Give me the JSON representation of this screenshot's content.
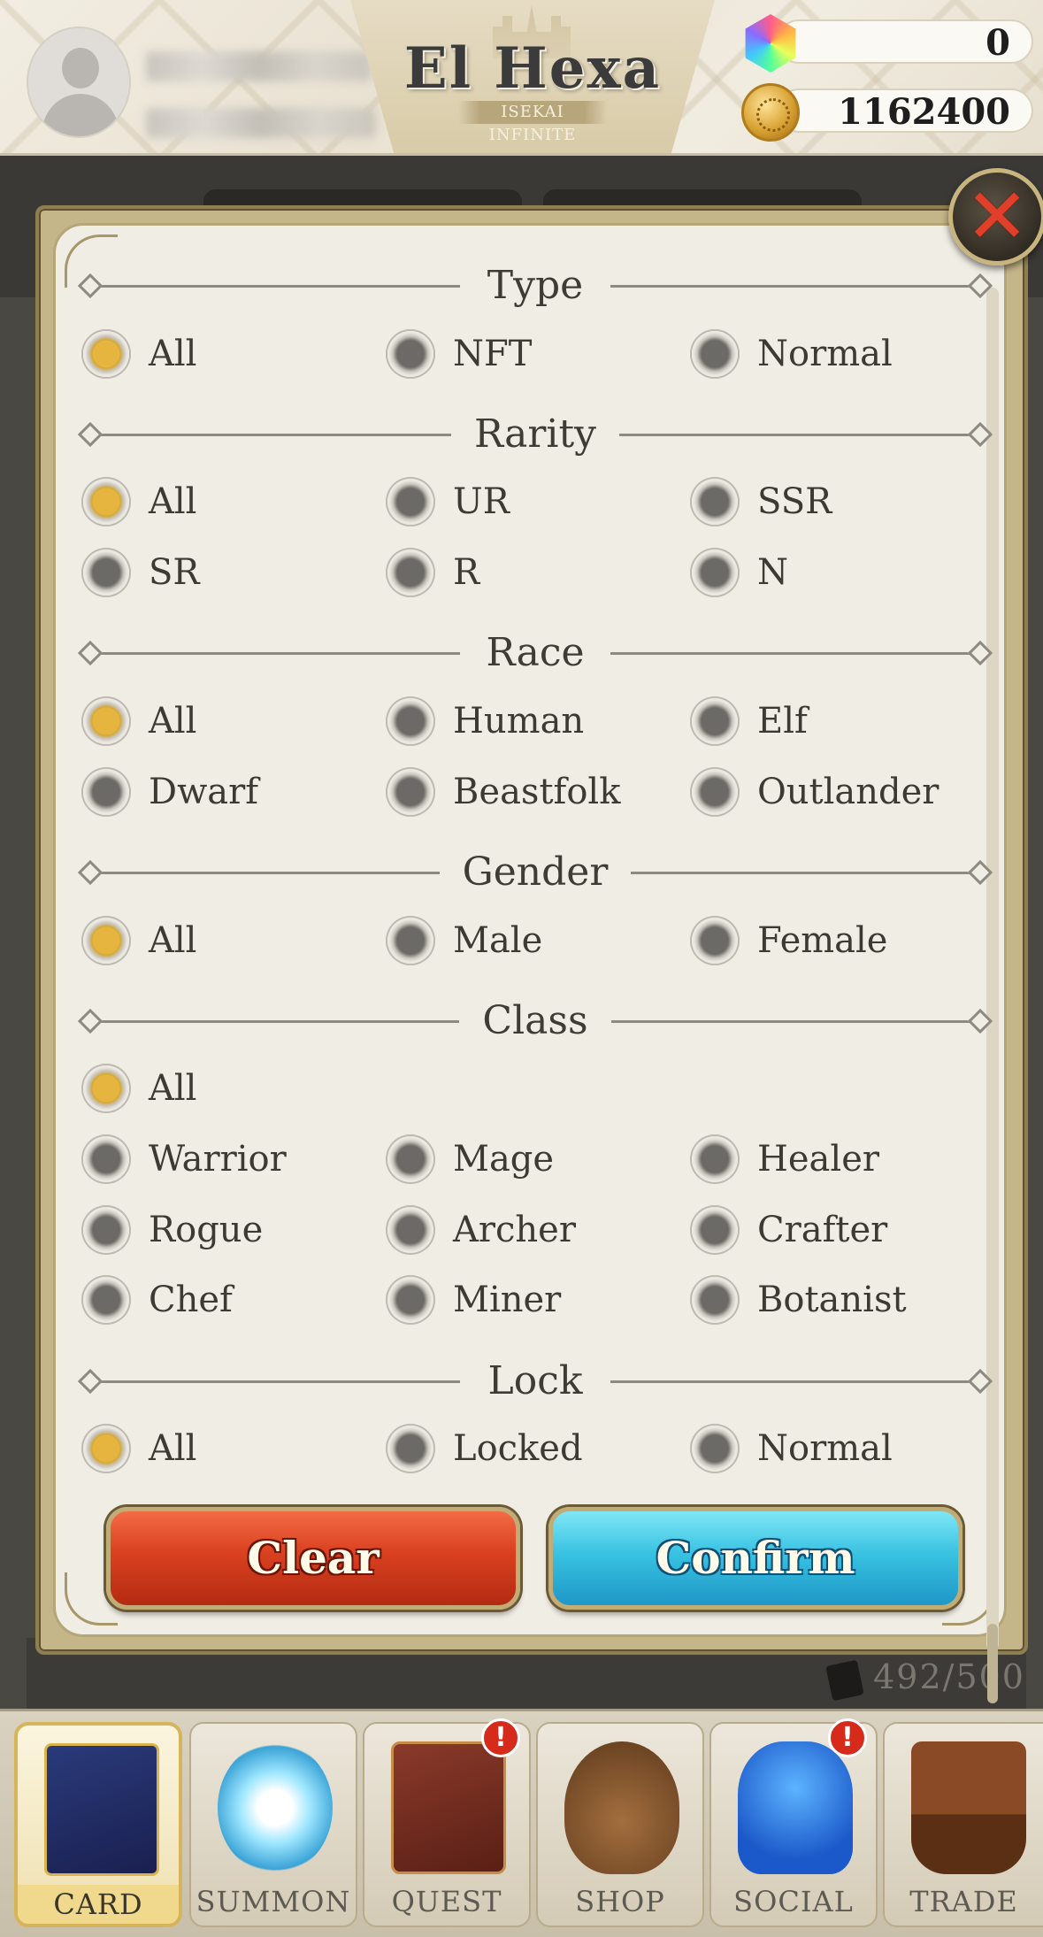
{
  "header": {
    "logo_title": "El Hexa",
    "logo_subtitle": "ISEKAI INFINITE",
    "gems": "0",
    "coins": "1162400"
  },
  "background": {
    "card_count": "492/500"
  },
  "modal": {
    "close_symbol": "✕",
    "sections": [
      {
        "key": "type",
        "title": "Type",
        "options": [
          {
            "label": "All",
            "selected": true
          },
          {
            "label": "NFT",
            "selected": false
          },
          {
            "label": "Normal",
            "selected": false
          }
        ]
      },
      {
        "key": "rarity",
        "title": "Rarity",
        "options": [
          {
            "label": "All",
            "selected": true
          },
          {
            "label": "UR",
            "selected": false
          },
          {
            "label": "SSR",
            "selected": false
          },
          {
            "label": "SR",
            "selected": false
          },
          {
            "label": "R",
            "selected": false
          },
          {
            "label": "N",
            "selected": false
          }
        ]
      },
      {
        "key": "race",
        "title": "Race",
        "options": [
          {
            "label": "All",
            "selected": true
          },
          {
            "label": "Human",
            "selected": false
          },
          {
            "label": "Elf",
            "selected": false
          },
          {
            "label": "Dwarf",
            "selected": false
          },
          {
            "label": "Beastfolk",
            "selected": false
          },
          {
            "label": "Outlander",
            "selected": false
          }
        ]
      },
      {
        "key": "gender",
        "title": "Gender",
        "options": [
          {
            "label": "All",
            "selected": true
          },
          {
            "label": "Male",
            "selected": false
          },
          {
            "label": "Female",
            "selected": false
          }
        ]
      },
      {
        "key": "class",
        "title": "Class",
        "options": [
          {
            "label": "All",
            "selected": true
          },
          {
            "label": "Warrior",
            "selected": false
          },
          {
            "label": "Mage",
            "selected": false
          },
          {
            "label": "Healer",
            "selected": false
          },
          {
            "label": "Rogue",
            "selected": false
          },
          {
            "label": "Archer",
            "selected": false
          },
          {
            "label": "Crafter",
            "selected": false
          },
          {
            "label": "Chef",
            "selected": false
          },
          {
            "label": "Miner",
            "selected": false
          },
          {
            "label": "Botanist",
            "selected": false
          }
        ]
      },
      {
        "key": "lock",
        "title": "Lock",
        "options": [
          {
            "label": "All",
            "selected": true
          },
          {
            "label": "Locked",
            "selected": false
          },
          {
            "label": "Normal",
            "selected": false
          }
        ]
      }
    ],
    "clear_label": "Clear",
    "confirm_label": "Confirm"
  },
  "nav": {
    "items": [
      {
        "label": "CARD",
        "active": true,
        "alert": false,
        "icon": "card-icon"
      },
      {
        "label": "SUMMON",
        "active": false,
        "alert": false,
        "icon": "summon-icon"
      },
      {
        "label": "QUEST",
        "active": false,
        "alert": true,
        "icon": "quest-book-icon"
      },
      {
        "label": "SHOP",
        "active": false,
        "alert": false,
        "icon": "shop-bag-icon"
      },
      {
        "label": "SOCIAL",
        "active": false,
        "alert": true,
        "icon": "social-people-icon"
      },
      {
        "label": "TRADE",
        "active": false,
        "alert": false,
        "icon": "gavel-icon"
      }
    ],
    "alert_symbol": "!"
  }
}
